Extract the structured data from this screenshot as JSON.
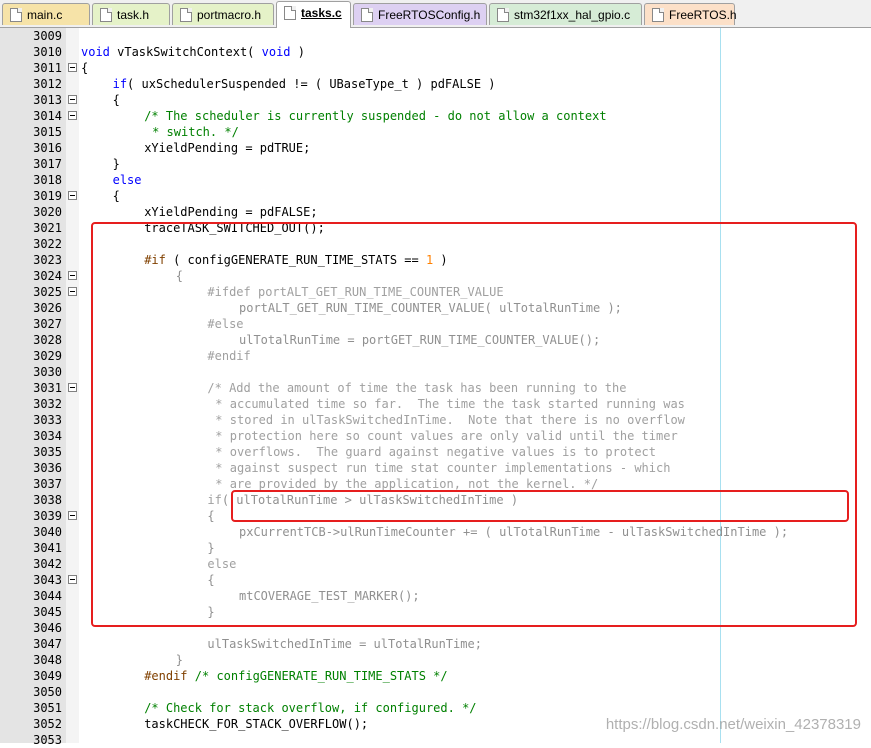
{
  "tabs": [
    {
      "label": "main.c",
      "color": "#f6e3a8",
      "active": false
    },
    {
      "label": "task.h",
      "color": "#e5f2c8",
      "active": false
    },
    {
      "label": "portmacro.h",
      "color": "#e5f2c8",
      "active": false
    },
    {
      "label": "tasks.c",
      "color": "#f8d8e0",
      "active": true
    },
    {
      "label": "FreeRTOSConfig.h",
      "color": "#ddd0f2",
      "active": false
    },
    {
      "label": "stm32f1xx_hal_gpio.c",
      "color": "#d6ecd6",
      "active": false
    },
    {
      "label": "FreeRTOS.h",
      "color": "#fce0c8",
      "active": false
    }
  ],
  "lines": [
    {
      "n": "3009",
      "fold": false,
      "indent": 0,
      "tokens": []
    },
    {
      "n": "3010",
      "fold": false,
      "indent": 0,
      "tokens": [
        {
          "t": "void",
          "c": "kw"
        },
        {
          "t": " vTaskSwitchContext( "
        },
        {
          "t": "void",
          "c": "kw"
        },
        {
          "t": " )"
        }
      ]
    },
    {
      "n": "3011",
      "fold": true,
      "indent": 0,
      "tokens": [
        {
          "t": "{"
        }
      ]
    },
    {
      "n": "3012",
      "fold": false,
      "indent": 4,
      "tokens": [
        {
          "t": "if",
          "c": "kw"
        },
        {
          "t": "( uxSchedulerSuspended != ( UBaseType_t ) pdFALSE )"
        }
      ]
    },
    {
      "n": "3013",
      "fold": true,
      "indent": 4,
      "tokens": [
        {
          "t": "{"
        }
      ]
    },
    {
      "n": "3014",
      "fold": true,
      "indent": 8,
      "tokens": [
        {
          "t": "/* The scheduler is currently suspended - do not allow a context",
          "c": "cm"
        }
      ]
    },
    {
      "n": "3015",
      "fold": false,
      "indent": 9,
      "tokens": [
        {
          "t": "* switch. */",
          "c": "cm"
        }
      ]
    },
    {
      "n": "3016",
      "fold": false,
      "indent": 8,
      "tokens": [
        {
          "t": "xYieldPending = pdTRUE;"
        }
      ]
    },
    {
      "n": "3017",
      "fold": false,
      "indent": 4,
      "tokens": [
        {
          "t": "}"
        }
      ]
    },
    {
      "n": "3018",
      "fold": false,
      "indent": 4,
      "tokens": [
        {
          "t": "else",
          "c": "kw"
        }
      ]
    },
    {
      "n": "3019",
      "fold": true,
      "indent": 4,
      "tokens": [
        {
          "t": "{"
        }
      ]
    },
    {
      "n": "3020",
      "fold": false,
      "indent": 8,
      "tokens": [
        {
          "t": "xYieldPending = pdFALSE;"
        }
      ]
    },
    {
      "n": "3021",
      "fold": false,
      "indent": 8,
      "tokens": [
        {
          "t": "traceTASK_SWITCHED_OUT();"
        }
      ]
    },
    {
      "n": "3022",
      "fold": false,
      "indent": 0,
      "tokens": []
    },
    {
      "n": "3023",
      "fold": false,
      "indent": 8,
      "tokens": [
        {
          "t": "#if",
          "c": "ppk"
        },
        {
          "t": " ( configGENERATE_RUN_TIME_STATS == "
        },
        {
          "t": "1",
          "c": "num"
        },
        {
          "t": " )"
        }
      ]
    },
    {
      "n": "3024",
      "fold": true,
      "indent": 12,
      "tokens": [
        {
          "t": "{",
          "c": "shade"
        }
      ]
    },
    {
      "n": "3025",
      "fold": true,
      "indent": 16,
      "tokens": [
        {
          "t": "#ifdef portALT_GET_RUN_TIME_COUNTER_VALUE",
          "c": "pp"
        }
      ]
    },
    {
      "n": "3026",
      "fold": false,
      "indent": 20,
      "tokens": [
        {
          "t": "portALT_GET_RUN_TIME_COUNTER_VALUE( ulTotalRunTime );",
          "c": "shade"
        }
      ]
    },
    {
      "n": "3027",
      "fold": false,
      "indent": 16,
      "tokens": [
        {
          "t": "#else",
          "c": "pp"
        }
      ]
    },
    {
      "n": "3028",
      "fold": false,
      "indent": 20,
      "tokens": [
        {
          "t": "ulTotalRunTime = portGET_RUN_TIME_COUNTER_VALUE();",
          "c": "shade"
        }
      ]
    },
    {
      "n": "3029",
      "fold": false,
      "indent": 16,
      "tokens": [
        {
          "t": "#endif",
          "c": "pp"
        }
      ]
    },
    {
      "n": "3030",
      "fold": false,
      "indent": 0,
      "tokens": []
    },
    {
      "n": "3031",
      "fold": true,
      "indent": 16,
      "tokens": [
        {
          "t": "/* Add the amount of time the task has been running to the",
          "c": "pp"
        }
      ]
    },
    {
      "n": "3032",
      "fold": false,
      "indent": 17,
      "tokens": [
        {
          "t": "* accumulated time so far.  The time the task started running was",
          "c": "pp"
        }
      ]
    },
    {
      "n": "3033",
      "fold": false,
      "indent": 17,
      "tokens": [
        {
          "t": "* stored in ulTaskSwitchedInTime.  Note that there is no overflow",
          "c": "pp"
        }
      ]
    },
    {
      "n": "3034",
      "fold": false,
      "indent": 17,
      "tokens": [
        {
          "t": "* protection here so count values are only valid until the timer",
          "c": "pp"
        }
      ]
    },
    {
      "n": "3035",
      "fold": false,
      "indent": 17,
      "tokens": [
        {
          "t": "* overflows.  The guard against negative values is to protect",
          "c": "pp"
        }
      ]
    },
    {
      "n": "3036",
      "fold": false,
      "indent": 17,
      "tokens": [
        {
          "t": "* against suspect run time stat counter implementations - which",
          "c": "pp"
        }
      ]
    },
    {
      "n": "3037",
      "fold": false,
      "indent": 17,
      "tokens": [
        {
          "t": "* are provided by the application, not the kernel. */",
          "c": "pp"
        }
      ]
    },
    {
      "n": "3038",
      "fold": false,
      "indent": 16,
      "tokens": [
        {
          "t": "if",
          "c": "pp"
        },
        {
          "t": "( ulTotalRunTime > ulTaskSwitchedInTime )",
          "c": "shade"
        }
      ]
    },
    {
      "n": "3039",
      "fold": true,
      "indent": 16,
      "tokens": [
        {
          "t": "{",
          "c": "shade"
        }
      ]
    },
    {
      "n": "3040",
      "fold": false,
      "indent": 20,
      "tokens": [
        {
          "t": "pxCurrentTCB->ulRunTimeCounter += ( ulTotalRunTime - ulTaskSwitchedInTime );",
          "c": "shade"
        }
      ]
    },
    {
      "n": "3041",
      "fold": false,
      "indent": 16,
      "tokens": [
        {
          "t": "}",
          "c": "shade"
        }
      ]
    },
    {
      "n": "3042",
      "fold": false,
      "indent": 16,
      "tokens": [
        {
          "t": "else",
          "c": "pp"
        }
      ]
    },
    {
      "n": "3043",
      "fold": true,
      "indent": 16,
      "tokens": [
        {
          "t": "{",
          "c": "shade"
        }
      ]
    },
    {
      "n": "3044",
      "fold": false,
      "indent": 20,
      "tokens": [
        {
          "t": "mtCOVERAGE_TEST_MARKER();",
          "c": "shade"
        }
      ]
    },
    {
      "n": "3045",
      "fold": false,
      "indent": 16,
      "tokens": [
        {
          "t": "}",
          "c": "shade"
        }
      ]
    },
    {
      "n": "3046",
      "fold": false,
      "indent": 0,
      "tokens": []
    },
    {
      "n": "3047",
      "fold": false,
      "indent": 16,
      "tokens": [
        {
          "t": "ulTaskSwitchedInTime = ulTotalRunTime;",
          "c": "shade"
        }
      ]
    },
    {
      "n": "3048",
      "fold": false,
      "indent": 12,
      "tokens": [
        {
          "t": "}",
          "c": "shade"
        }
      ]
    },
    {
      "n": "3049",
      "fold": false,
      "indent": 8,
      "tokens": [
        {
          "t": "#endif",
          "c": "ppk"
        },
        {
          "t": " /* configGENERATE_RUN_TIME_STATS */",
          "c": "cm"
        }
      ]
    },
    {
      "n": "3050",
      "fold": false,
      "indent": 0,
      "tokens": []
    },
    {
      "n": "3051",
      "fold": false,
      "indent": 8,
      "tokens": [
        {
          "t": "/* Check for stack overflow, if configured. */",
          "c": "cm"
        }
      ]
    },
    {
      "n": "3052",
      "fold": false,
      "indent": 8,
      "tokens": [
        {
          "t": "taskCHECK_FOR_STACK_OVERFLOW();"
        }
      ]
    },
    {
      "n": "3053",
      "fold": false,
      "indent": 0,
      "tokens": []
    }
  ],
  "watermark": "https://blog.csdn.net/weixin_42378319"
}
